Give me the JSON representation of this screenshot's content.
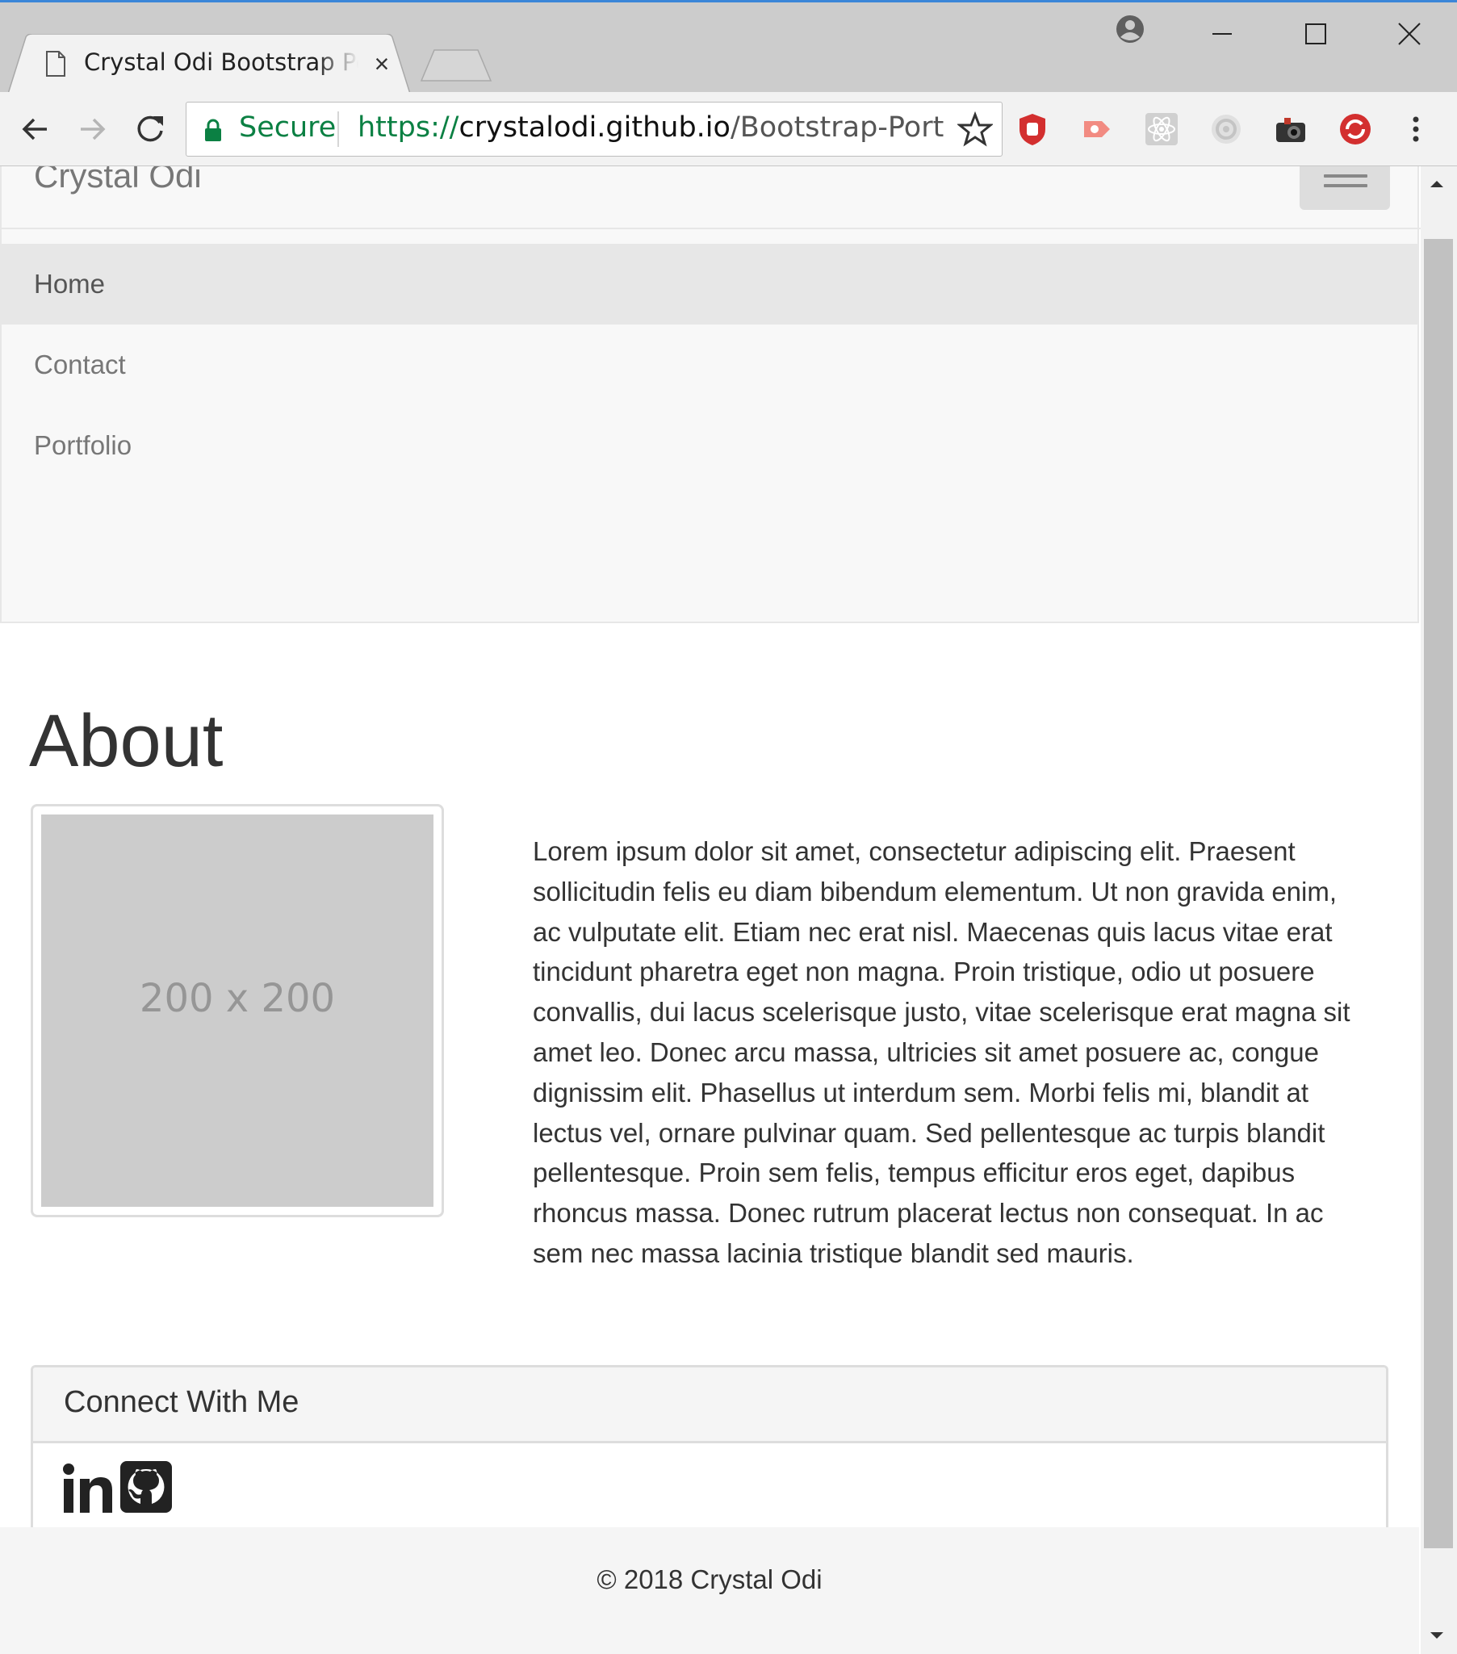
{
  "browser": {
    "tab_title": "Crystal Odi Bootstrap Portfolio",
    "tab_close": "×",
    "secure_label": "Secure",
    "url_scheme": "https://",
    "url_host": "crystalodi.github.io",
    "url_path": "/Bootstrap-Portfoli...",
    "icons": [
      "page-icon",
      "profile-icon",
      "minimize-icon",
      "maximize-icon",
      "close-icon",
      "back-icon",
      "forward-icon",
      "reload-icon",
      "lock-icon",
      "star-icon",
      "ublock-icon",
      "cast-icon",
      "react-devtools-icon",
      "camera-lens-icon",
      "screenshot-icon",
      "lastpass-icon",
      "menu-icon"
    ],
    "colors": {
      "accent": "#3b86d8",
      "secure_green": "#0b8043"
    }
  },
  "navbar": {
    "brand": "Crystal Odi",
    "items": [
      {
        "label": "Home",
        "active": true
      },
      {
        "label": "Contact",
        "active": false
      },
      {
        "label": "Portfolio",
        "active": false
      }
    ]
  },
  "about": {
    "title": "About",
    "image_placeholder": "200 x 200",
    "text": "Lorem ipsum dolor sit amet, consectetur adipiscing elit. Praesent sollicitudin felis eu diam bibendum elementum. Ut non gravida enim, ac vulputate elit. Etiam nec erat nisl. Maecenas quis lacus vitae erat tincidunt pharetra eget non magna. Proin tristique, odio ut posuere convallis, dui lacus scelerisque justo, vitae scelerisque erat magna sit amet leo. Donec arcu massa, ultricies sit amet posuere ac, congue dignissim elit. Phasellus ut interdum sem. Morbi felis mi, blandit at lectus vel, ornare pulvinar quam. Sed pellentesque ac turpis blandit pellentesque. Proin sem felis, tempus efficitur eros eget, dapibus rhoncus massa. Donec rutrum placerat lectus non consequat. In ac sem nec massa lacinia tristique blandit sed mauris."
  },
  "connect": {
    "title": "Connect With Me",
    "icons": [
      "linkedin-icon",
      "github-icon"
    ]
  },
  "footer": {
    "text": "© 2018 Crystal Odi"
  }
}
